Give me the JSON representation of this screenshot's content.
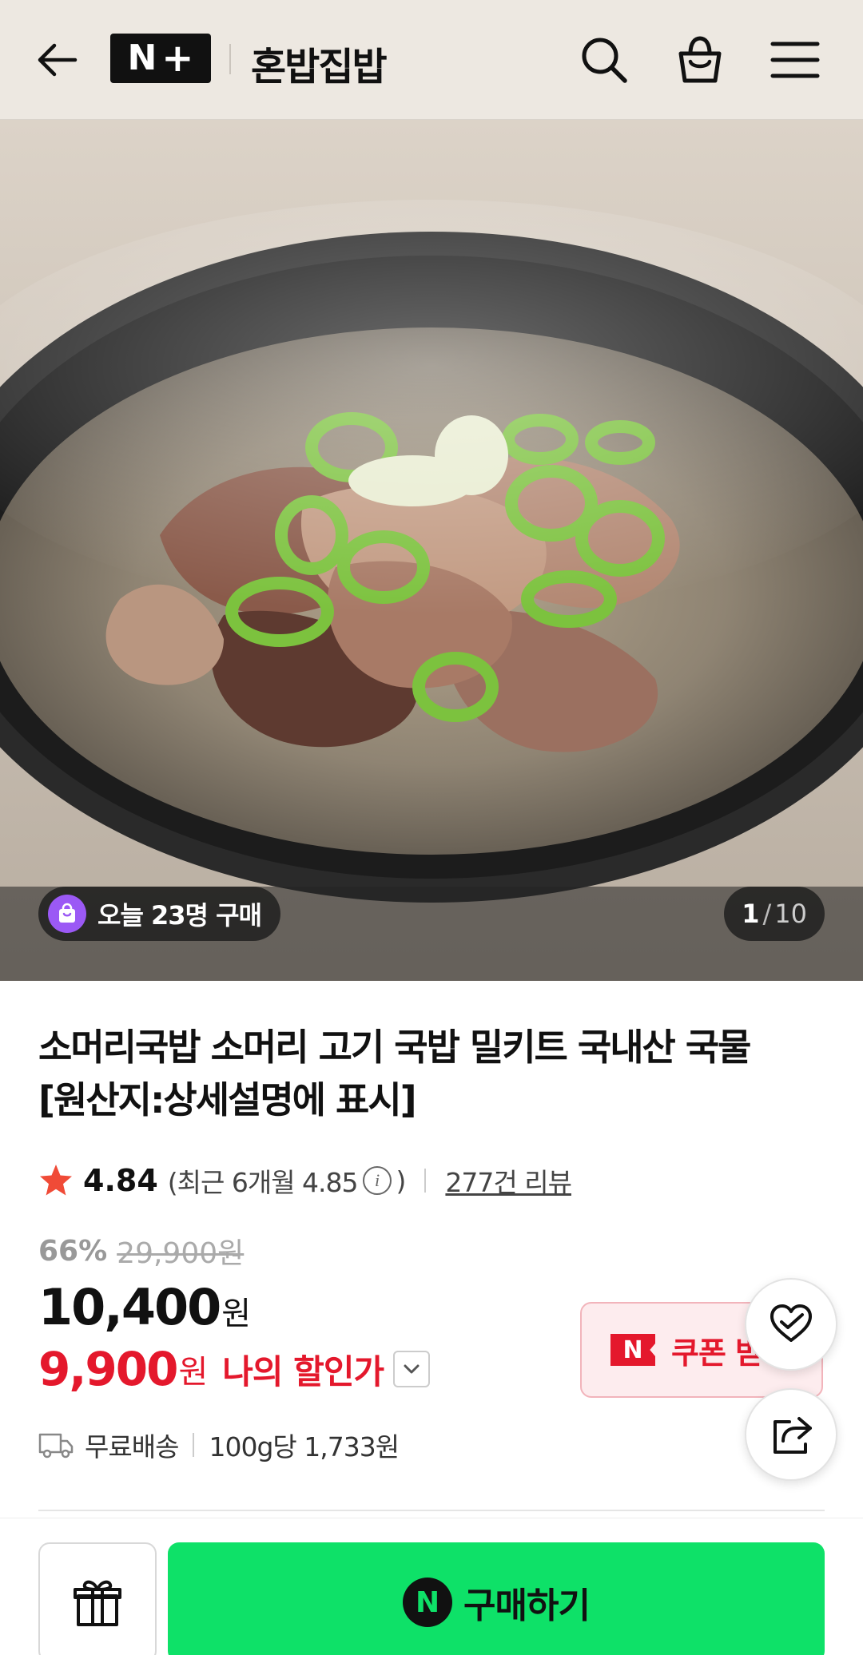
{
  "header": {
    "logo_text": "N+",
    "store_name": "혼밥집밥",
    "icons": [
      "back-arrow-icon",
      "search-icon",
      "shopping-bag-icon",
      "hamburger-menu-icon"
    ]
  },
  "hero": {
    "image_description": "soup-bowl-photo",
    "purchase_badge": "오늘 23명 구매",
    "pager": {
      "current": "1",
      "separator": "/",
      "total": "10"
    }
  },
  "product": {
    "title": "소머리국밥 소머리 고기 국밥 밀키트 국내산 국물 [원산지:상세설명에 표시]",
    "rating": "4.84",
    "recent_rating_prefix": "(최근 6개월 4.85",
    "recent_rating_suffix": ")",
    "review_count": "277건 리뷰",
    "discount_rate": "66%",
    "original_price": "29,900원",
    "price": "10,400",
    "price_unit": "원",
    "my_price": "9,900",
    "my_price_unit": "원",
    "my_price_label": "나의 할인가",
    "shipping": "무료배송",
    "unit_price": "100g당 1,733원"
  },
  "coupon": {
    "icon_text": "N",
    "label": "쿠폰 받기"
  },
  "bottom_bar": {
    "buy_icon_text": "N",
    "buy_label": "구매하기"
  },
  "colors": {
    "header_bg": "#ede8e1",
    "accent_red": "#e4182c",
    "buy_green": "#0ee168",
    "star": "#f04b37",
    "badge_purple": "#9b59f5"
  }
}
